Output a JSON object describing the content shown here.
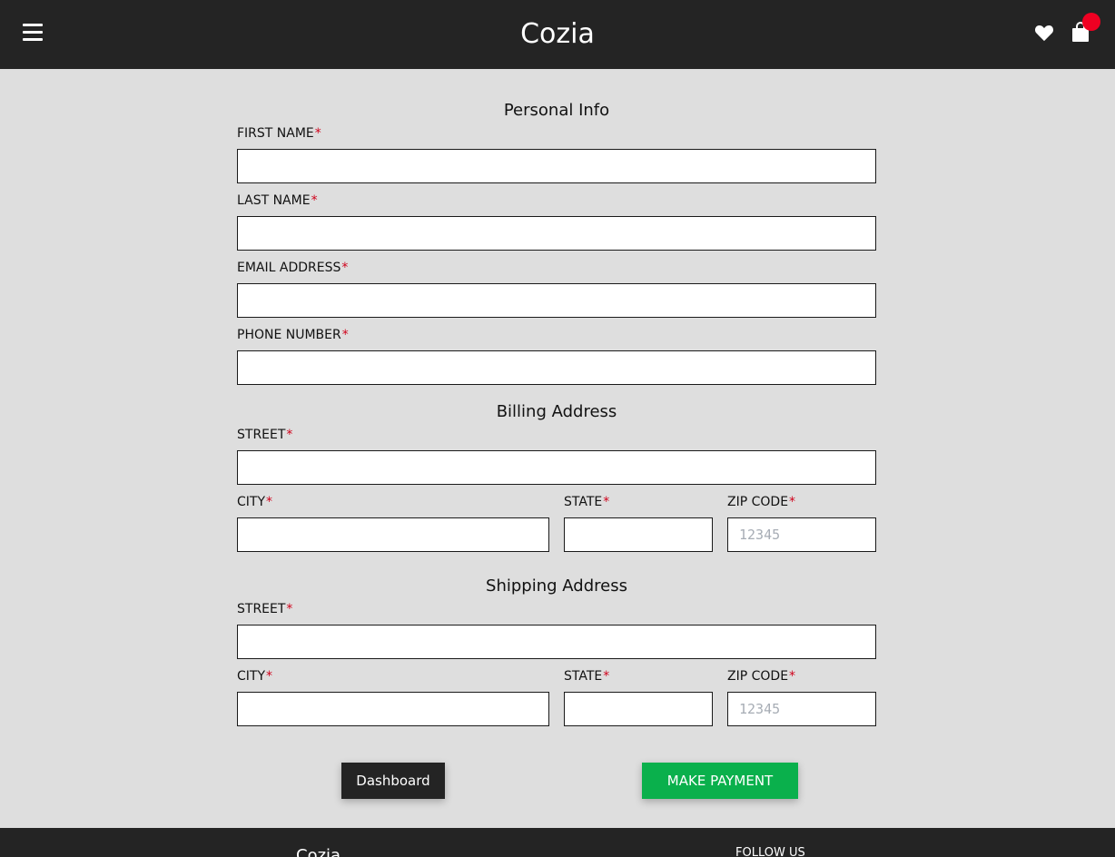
{
  "header": {
    "brand": "Cozia"
  },
  "colors": {
    "header_bg": "#242424",
    "page_bg": "#dedede",
    "required_marker": "#d0021b",
    "cart_badge": "#ef0022",
    "pay_button": "#0ab04c",
    "dashboard_button": "#242424"
  },
  "icons": {
    "menu": "hamburger-menu-icon",
    "wishlist": "heart-icon",
    "cart": "shopping-bag-icon"
  },
  "personal_info": {
    "title": "Personal Info",
    "first_name_label": "FIRST NAME",
    "last_name_label": "LAST NAME",
    "email_label": "EMAIL ADDRESS",
    "phone_label": "PHONE NUMBER",
    "first_name_value": "",
    "last_name_value": "",
    "email_value": "",
    "phone_value": ""
  },
  "billing": {
    "title": "Billing Address",
    "street_label": "STREET",
    "city_label": "CITY",
    "state_label": "STATE",
    "zip_label": "ZIP CODE",
    "zip_placeholder": "12345",
    "street_value": "",
    "city_value": "",
    "state_value": "",
    "zip_value": ""
  },
  "shipping": {
    "title": "Shipping Address",
    "street_label": "STREET",
    "city_label": "CITY",
    "state_label": "STATE",
    "zip_label": "ZIP CODE",
    "zip_placeholder": "12345",
    "street_value": "",
    "city_value": "",
    "state_value": "",
    "zip_value": ""
  },
  "required_marker": "*",
  "actions": {
    "dashboard_label": "Dashboard",
    "payment_label": "MAKE PAYMENT"
  },
  "footer": {
    "brand": "Cozia",
    "follow_label": "FOLLOW US"
  }
}
